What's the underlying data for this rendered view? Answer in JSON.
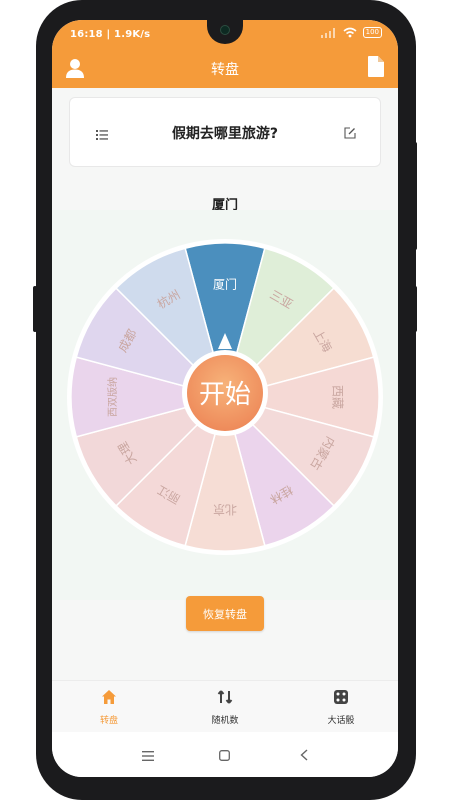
{
  "status": {
    "time": "16:18 | 1.9K/s",
    "battery": "100"
  },
  "appbar": {
    "title": "转盘",
    "left_icon": "user-icon",
    "right_icon": "file-icon"
  },
  "question": {
    "title": "假期去哪里旅游?",
    "list_icon": "list-icon",
    "edit_icon": "edit-icon"
  },
  "result": "厦门",
  "wheel": {
    "center_label": "开始",
    "segments": [
      {
        "label": "厦门",
        "color": "#4b8fbe"
      },
      {
        "label": "三亚",
        "color": "#dfeed8"
      },
      {
        "label": "上海",
        "color": "#f6ddd2"
      },
      {
        "label": "西藏",
        "color": "#f5d9d5"
      },
      {
        "label": "内蒙古",
        "color": "#f3dad9"
      },
      {
        "label": "桂林",
        "color": "#ebd4ec"
      },
      {
        "label": "北京",
        "color": "#f6ddd5"
      },
      {
        "label": "丽江",
        "color": "#f4d9d8"
      },
      {
        "label": "大理",
        "color": "#f2d8d9"
      },
      {
        "label": "西双版纳",
        "color": "#ead5ec"
      },
      {
        "label": "成都",
        "color": "#dfd6ee"
      },
      {
        "label": "杭州",
        "color": "#cfdbed"
      }
    ]
  },
  "reset_label": "恢复转盘",
  "tabs": [
    {
      "label": "转盘",
      "icon": "home-icon",
      "active": true
    },
    {
      "label": "随机数",
      "icon": "shuffle-icon",
      "active": false
    },
    {
      "label": "大话骰",
      "icon": "dice-icon",
      "active": false
    }
  ],
  "colors": {
    "accent": "#f59b3a",
    "selected_segment": "#4b8fbe"
  }
}
